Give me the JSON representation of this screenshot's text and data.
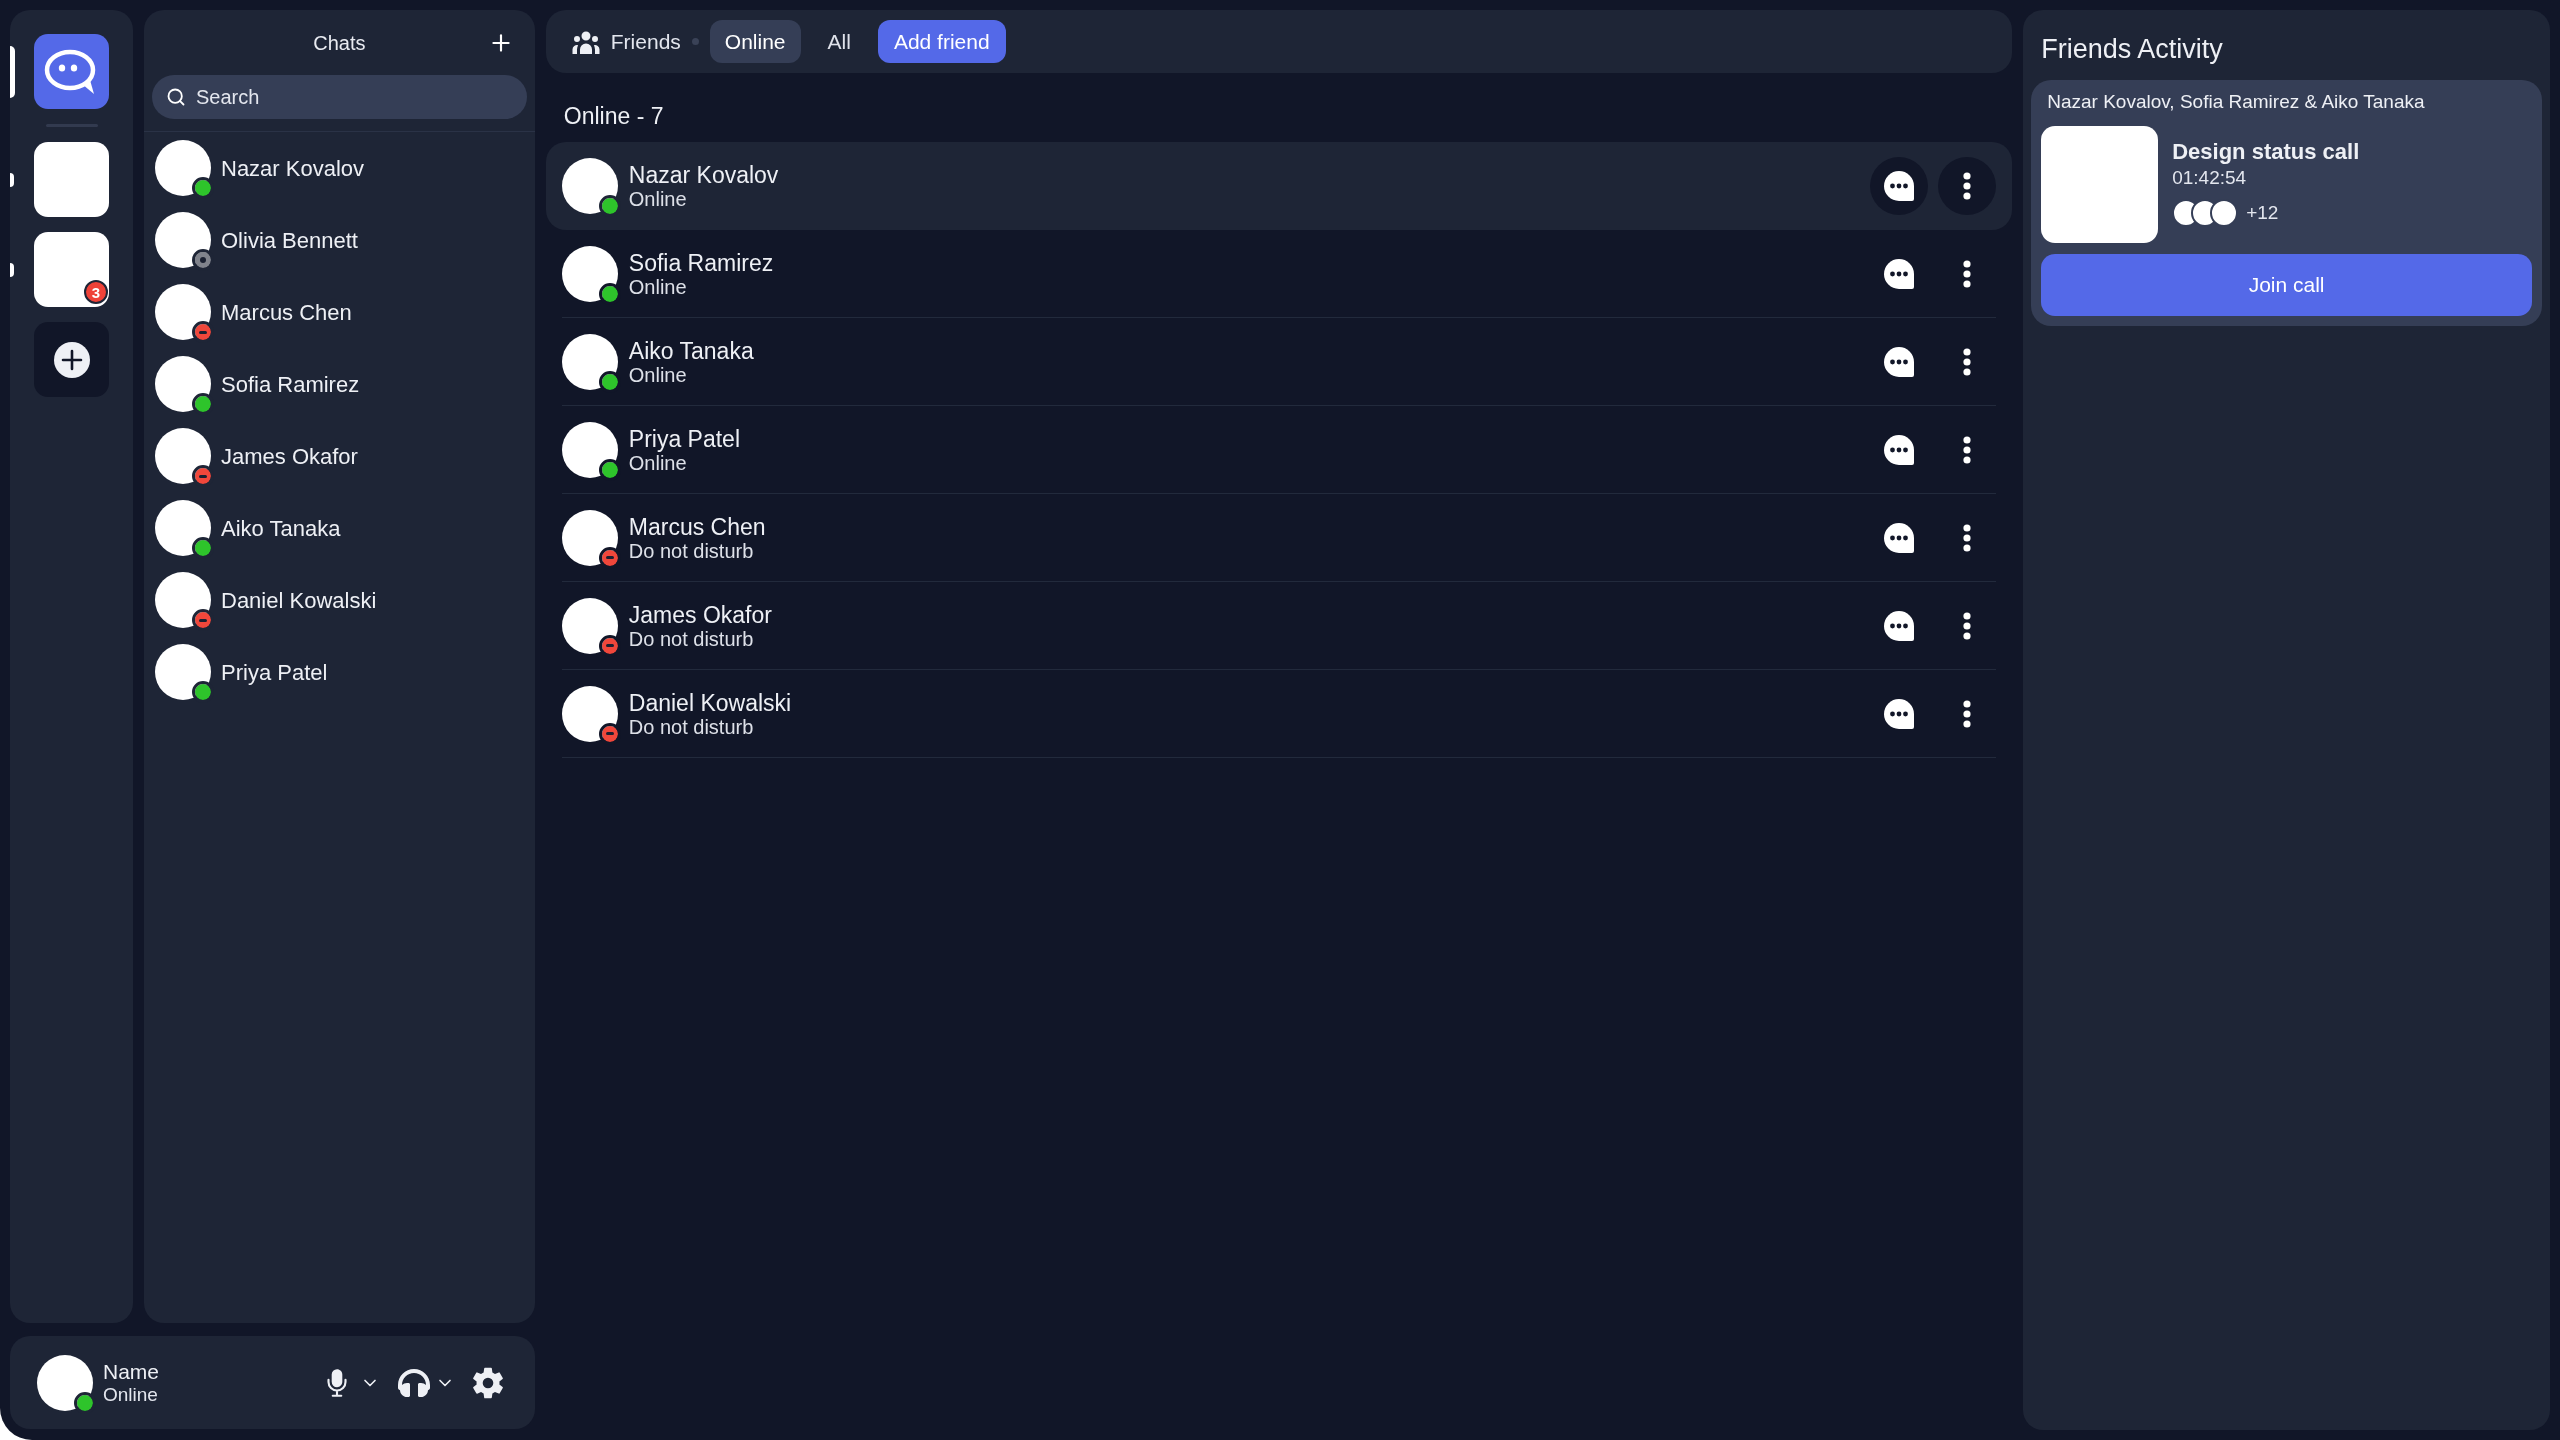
{
  "rail": {
    "servers": [
      {
        "kind": "app",
        "selected": true
      },
      {
        "kind": "server",
        "selected": false,
        "unread": true
      },
      {
        "kind": "server",
        "selected": false,
        "unread": true,
        "badge": "3"
      }
    ]
  },
  "chats": {
    "title": "Chats",
    "search": {
      "placeholder": "Search"
    },
    "items": [
      {
        "name": "Nazar Kovalov",
        "kind": "online",
        "color": "#2ec42b"
      },
      {
        "name": "Olivia Bennett",
        "kind": "offline",
        "color": "#80838c"
      },
      {
        "name": "Marcus Chen",
        "kind": "dnd",
        "color": "#f0473b"
      },
      {
        "name": "Sofia Ramirez",
        "kind": "online",
        "color": "#2ec42b"
      },
      {
        "name": "James Okafor",
        "kind": "dnd",
        "color": "#f0473b"
      },
      {
        "name": "Aiko Tanaka",
        "kind": "online",
        "color": "#2ec42b"
      },
      {
        "name": "Daniel Kowalski",
        "kind": "dnd",
        "color": "#f0473b"
      },
      {
        "name": "Priya Patel",
        "kind": "online",
        "color": "#2ec42b"
      }
    ]
  },
  "user_panel": {
    "name": "Name",
    "status_text": "Online",
    "kind": "online",
    "color": "#2ec42b"
  },
  "top_bar": {
    "title": "Friends",
    "tabs": [
      {
        "label": "Online",
        "selected": true
      },
      {
        "label": "All",
        "selected": false
      }
    ],
    "add_button": "Add friend"
  },
  "friends": {
    "heading": "Online - 7",
    "rows": [
      {
        "name": "Nazar Kovalov",
        "status_text": "Online",
        "kind": "online",
        "color": "#2ec42b",
        "hovered": true
      },
      {
        "name": "Sofia Ramirez",
        "status_text": "Online",
        "kind": "online",
        "color": "#2ec42b",
        "hovered": false
      },
      {
        "name": "Aiko Tanaka",
        "status_text": "Online",
        "kind": "online",
        "color": "#2ec42b",
        "hovered": false
      },
      {
        "name": "Priya Patel",
        "status_text": "Online",
        "kind": "online",
        "color": "#2ec42b",
        "hovered": false
      },
      {
        "name": "Marcus Chen",
        "status_text": "Do not disturb",
        "kind": "dnd",
        "color": "#f0473b",
        "hovered": false
      },
      {
        "name": "James Okafor",
        "status_text": "Do not disturb",
        "kind": "dnd",
        "color": "#f0473b",
        "hovered": false
      },
      {
        "name": "Daniel Kowalski",
        "status_text": "Do not disturb",
        "kind": "dnd",
        "color": "#f0473b",
        "hovered": false
      }
    ]
  },
  "activity": {
    "title": "Friends Activity",
    "card": {
      "participants": "Nazar Kovalov, Sofia Ramirez & Aiko Tanaka",
      "call_title": "Design status call",
      "duration": "01:42:54",
      "more_count": "+12",
      "join_button": "Join call"
    }
  }
}
